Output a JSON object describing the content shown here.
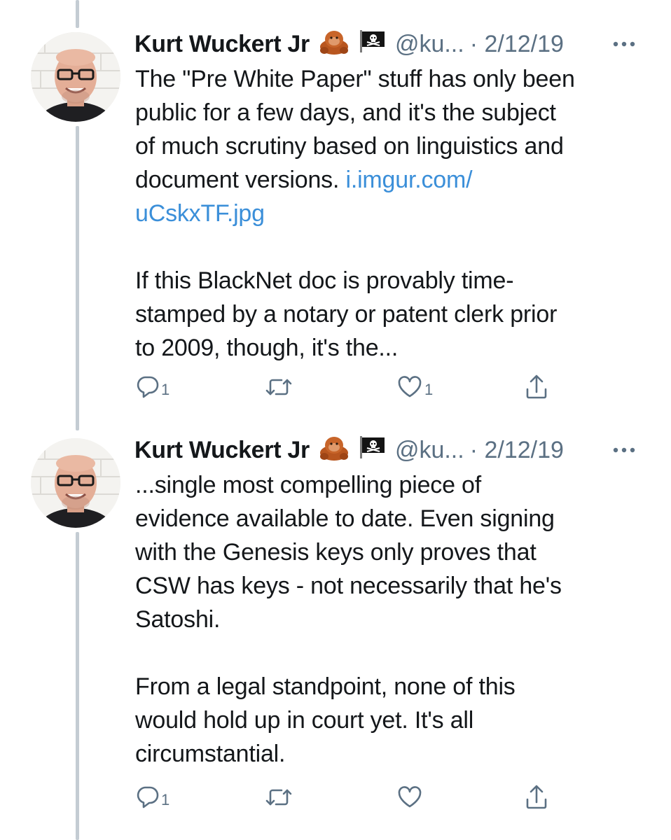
{
  "tweets": [
    {
      "author_name": "Kurt Wuckert Jr",
      "handle": "@ku...",
      "date": "· 2/12/19",
      "more_icon": "more-horizontal-icon",
      "lines": [
        "The \"Pre White Paper\" stuff has only been",
        "public for a few days, and it's the subject",
        "of much scrutiny based on linguistics and",
        "document versions. "
      ],
      "link_line1": "i.imgur.com/",
      "link_line2": "uCskxTF.jpg",
      "para2": [
        "If this BlackNet doc is provably time-",
        "stamped by a notary or patent clerk prior",
        "to 2009, though, it's the..."
      ],
      "reply_count": "1",
      "retweet_count": "",
      "like_count": "1",
      "share_icon": "share-icon"
    },
    {
      "author_name": "Kurt Wuckert Jr",
      "handle": "@ku...",
      "date": "· 2/12/19",
      "more_icon": "more-horizontal-icon",
      "para1": [
        "...single most compelling piece of",
        "evidence available to date. Even signing",
        "with the Genesis keys only proves that",
        "CSW has keys - not necessarily that he's",
        "Satoshi."
      ],
      "para2": [
        "From a legal standpoint, none of this",
        "would hold up in court yet. It's all",
        "circumstantial."
      ],
      "reply_count": "1",
      "retweet_count": "",
      "like_count": "",
      "share_icon": "share-icon"
    }
  ],
  "colors": {
    "text": "#14171a",
    "secondary": "#5b7083",
    "link": "#3b8fd9",
    "thread_line": "#c4ccd3"
  }
}
